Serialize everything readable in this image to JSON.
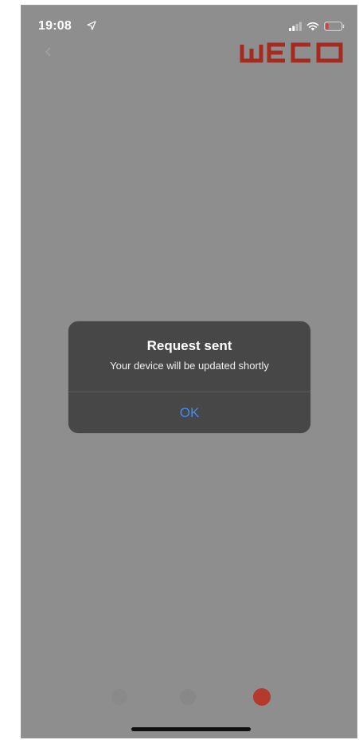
{
  "status_bar": {
    "time": "19:08"
  },
  "brand": {
    "logo_text": "WECO",
    "color": "#b3261e"
  },
  "dialog": {
    "title": "Request sent",
    "message": "Your device will be updated shortly",
    "ok_label": "OK",
    "button_color": "#3d8df5"
  },
  "tab_bar": {
    "items": [
      {
        "icon": "tab-icon-1"
      },
      {
        "icon": "tab-icon-2"
      },
      {
        "icon": "tab-icon-3",
        "color": "#b33a2c",
        "active": true
      }
    ]
  }
}
